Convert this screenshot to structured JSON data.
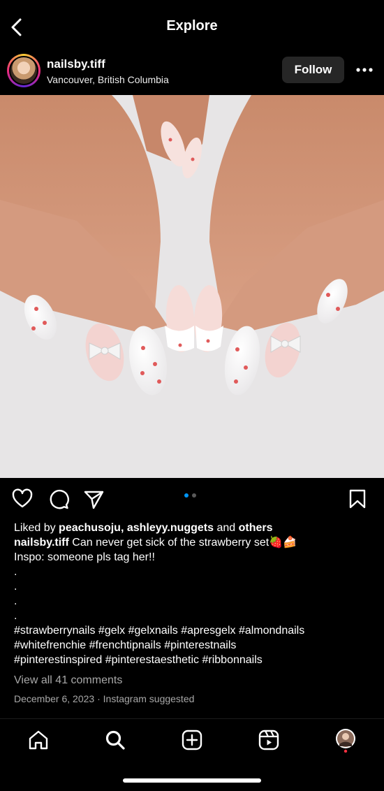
{
  "header": {
    "title": "Explore"
  },
  "post": {
    "username": "nailsby.tiff",
    "location": "Vancouver, British Columbia",
    "follow_label": "Follow",
    "likes_prefix": "Liked by ",
    "likes_users": "peachusoju, ashleyy.nuggets",
    "likes_mid": " and ",
    "likes_others": "others",
    "caption_user": "nailsby.tiff",
    "caption_text": " Can never get sick of the strawberry set🍓🍰",
    "caption_line2": "Inspo: someone pls tag her!!",
    "caption_dots": [
      ".",
      ".",
      ".",
      "."
    ],
    "hashtags_1": "#strawberrynails #gelx #gelxnails #apresgelx #almondnails",
    "hashtags_2": "#whitefrenchie #frenchtipnails #pinterestnails",
    "hashtags_3": "#pinterestinspired #pinterestaesthetic #ribbonnails",
    "comments_link": "View all 41 comments",
    "date": "December 6, 2023",
    "separator": "·",
    "suggested": "Instagram suggested",
    "carousel": {
      "count": 2,
      "active": 1
    }
  },
  "colors": {
    "accent": "#0095f6",
    "follow_bg": "#262626",
    "muted": "#a8a8a8",
    "notify": "#ff3040"
  },
  "icons": [
    "back-arrow-icon",
    "more-options-icon",
    "heart-icon",
    "comment-icon",
    "share-icon",
    "bookmark-icon",
    "home-icon",
    "search-icon",
    "create-icon",
    "reels-icon",
    "profile-avatar"
  ]
}
